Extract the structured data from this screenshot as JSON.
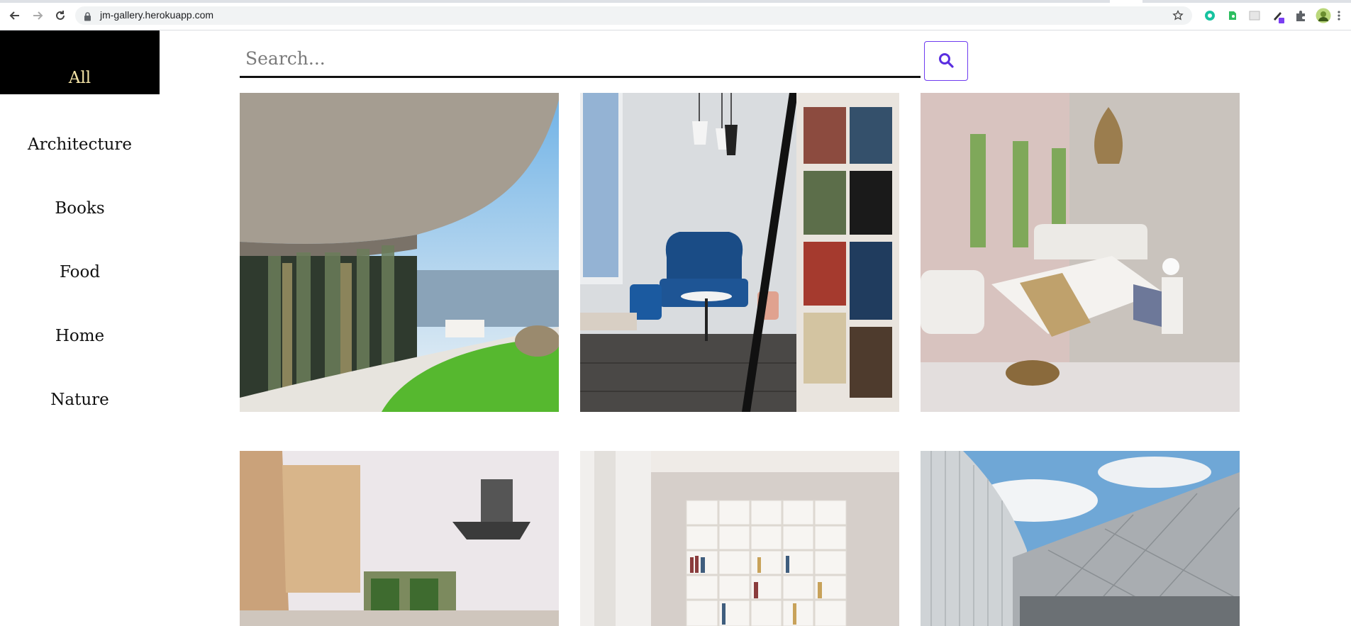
{
  "browser": {
    "url": "jm-gallery.herokuapp.com"
  },
  "sidebar": {
    "items": [
      {
        "label": "All"
      },
      {
        "label": "Architecture"
      },
      {
        "label": "Books"
      },
      {
        "label": "Food"
      },
      {
        "label": "Home"
      },
      {
        "label": "Nature"
      }
    ]
  },
  "search": {
    "placeholder": "Search..."
  },
  "colors": {
    "accent": "#6e3cf0",
    "active_bg": "#000000",
    "active_text": "#f3e3a6"
  },
  "gallery": {
    "images": [
      {
        "subject": "curved-glass-architecture"
      },
      {
        "subject": "library-living-room"
      },
      {
        "subject": "pink-bedroom"
      },
      {
        "subject": "kitchen-interior"
      },
      {
        "subject": "bookshelf-room"
      },
      {
        "subject": "modern-facade"
      }
    ]
  }
}
